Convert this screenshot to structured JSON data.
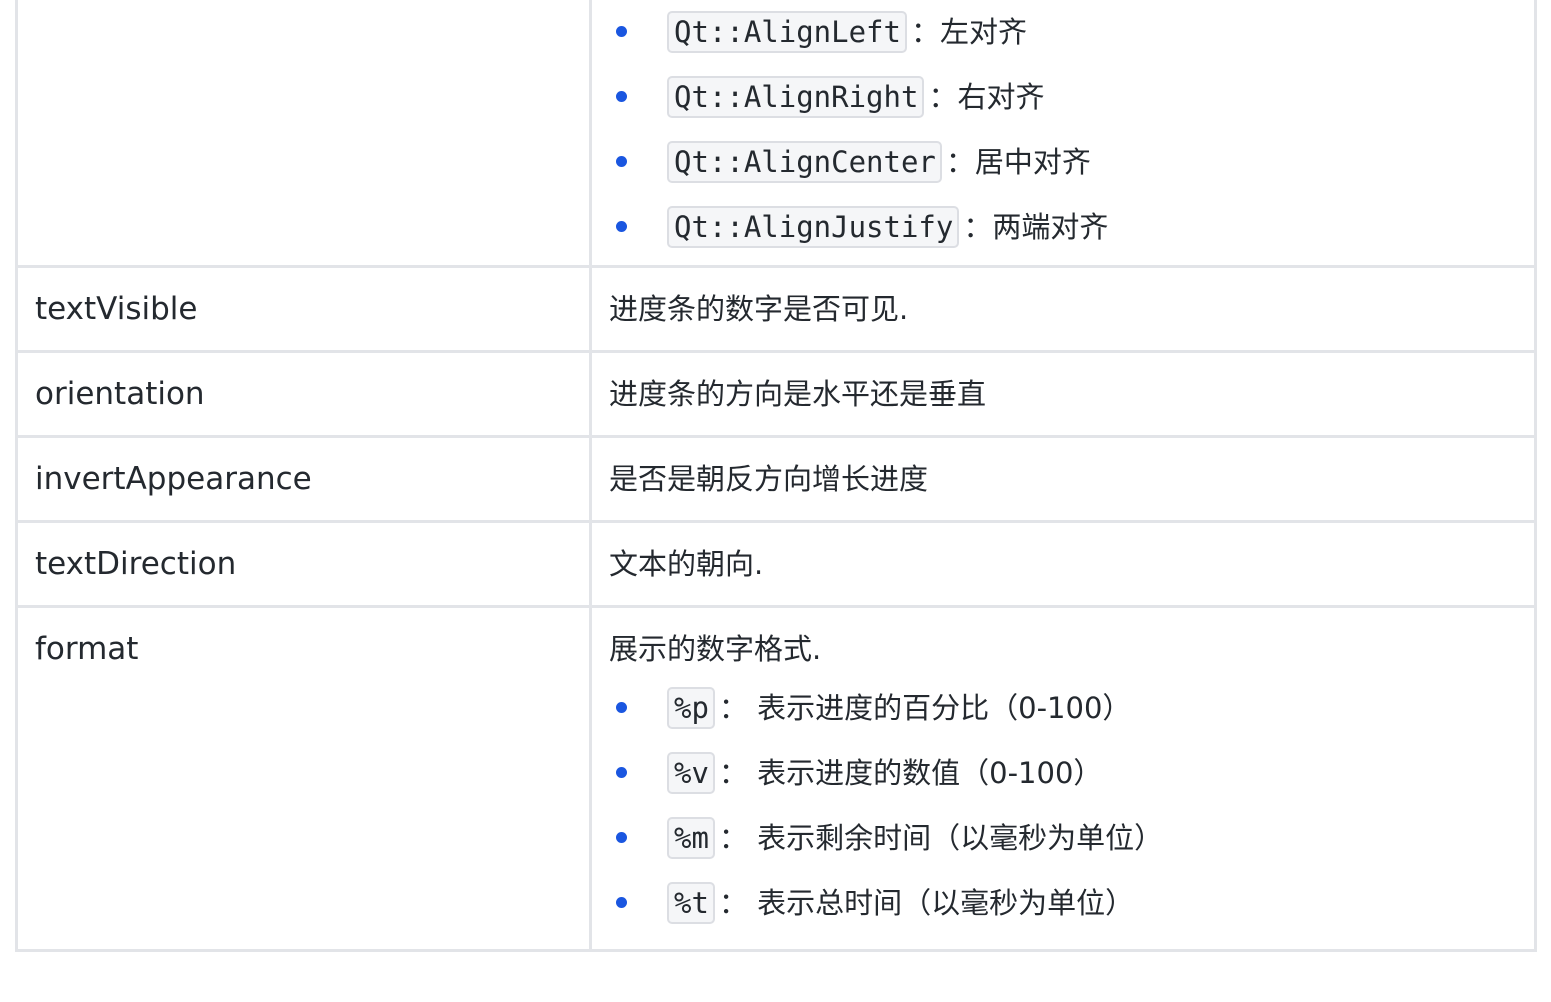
{
  "rows": [
    {
      "name": "",
      "items": [
        {
          "code": "Qt::AlignLeft",
          "text": "：左对齐"
        },
        {
          "code": "Qt::AlignRight",
          "text": "：右对齐"
        },
        {
          "code": "Qt::AlignCenter",
          "text": "：居中对齐"
        },
        {
          "code": "Qt::AlignJustify",
          "text": "：两端对齐"
        }
      ]
    },
    {
      "name": "textVisible",
      "desc": "进度条的数字是否可见."
    },
    {
      "name": "orientation",
      "desc": "进度条的方向是水平还是垂直"
    },
    {
      "name": "invertAppearance",
      "desc": "是否是朝反方向增长进度"
    },
    {
      "name": "textDirection",
      "desc": "文本的朝向."
    },
    {
      "name": "format",
      "desc": "展示的数字格式.",
      "items": [
        {
          "code": "%p",
          "text": "： 表示进度的百分比（0-100）"
        },
        {
          "code": "%v",
          "text": "： 表示进度的数值（0-100）"
        },
        {
          "code": "%m",
          "text": "： 表示剩余时间（以毫秒为单位）"
        },
        {
          "code": "%t",
          "text": "： 表示总时间（以毫秒为单位）"
        }
      ]
    }
  ],
  "colors": {
    "bullet": "#1a56e0",
    "border": "#e2e4e8",
    "code_bg": "#f5f6f8"
  }
}
